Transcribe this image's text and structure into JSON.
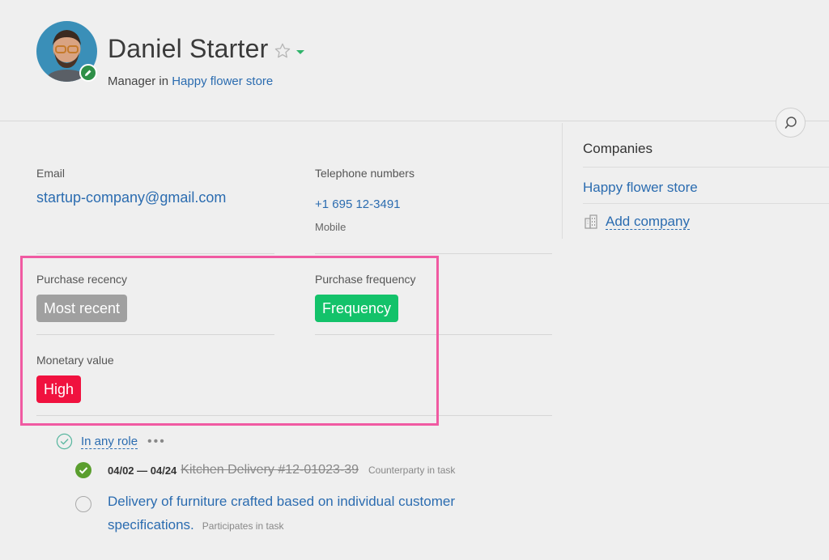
{
  "contact": {
    "name": "Daniel Starter",
    "role_prefix": "Manager in",
    "company_link": "Happy flower store"
  },
  "companies": {
    "title": "Companies",
    "items": [
      "Happy flower store"
    ],
    "add_label": "Add company"
  },
  "fields": {
    "email_label": "Email",
    "email_value": "startup-company@gmail.com",
    "phone_label": "Telephone numbers",
    "phone_value": "+1 695 12-3491",
    "phone_type": "Mobile",
    "recency_label": "Purchase recency",
    "recency_value": "Most recent",
    "frequency_label": "Purchase frequency",
    "frequency_value": "Frequency",
    "monetary_label": "Monetary value",
    "monetary_value": "High"
  },
  "tasks": {
    "role_filter": "In any role",
    "more": "•••",
    "items": [
      {
        "dates": "04/02 — 04/24",
        "title": "Kitchen Delivery #12-01023-39",
        "role": "Counterparty in task",
        "done": true
      },
      {
        "title": "Delivery of furniture crafted based on individual customer specifications.",
        "role": "Participates in task",
        "done": false
      }
    ]
  },
  "colors": {
    "link": "#2b6cb0",
    "tag_recency": "#a0a0a0",
    "tag_frequency": "#13c26a",
    "tag_monetary": "#f0123f",
    "highlight": "#f05aa2",
    "task_done": "#5a9e2e"
  },
  "icons": {
    "avatar": "avatar",
    "edit": "pencil-icon",
    "star": "star-icon",
    "search": "search-icon",
    "company": "building-icon",
    "role_check": "check-circle-icon",
    "task_done": "check-filled-icon",
    "task_open": "circle-icon"
  }
}
